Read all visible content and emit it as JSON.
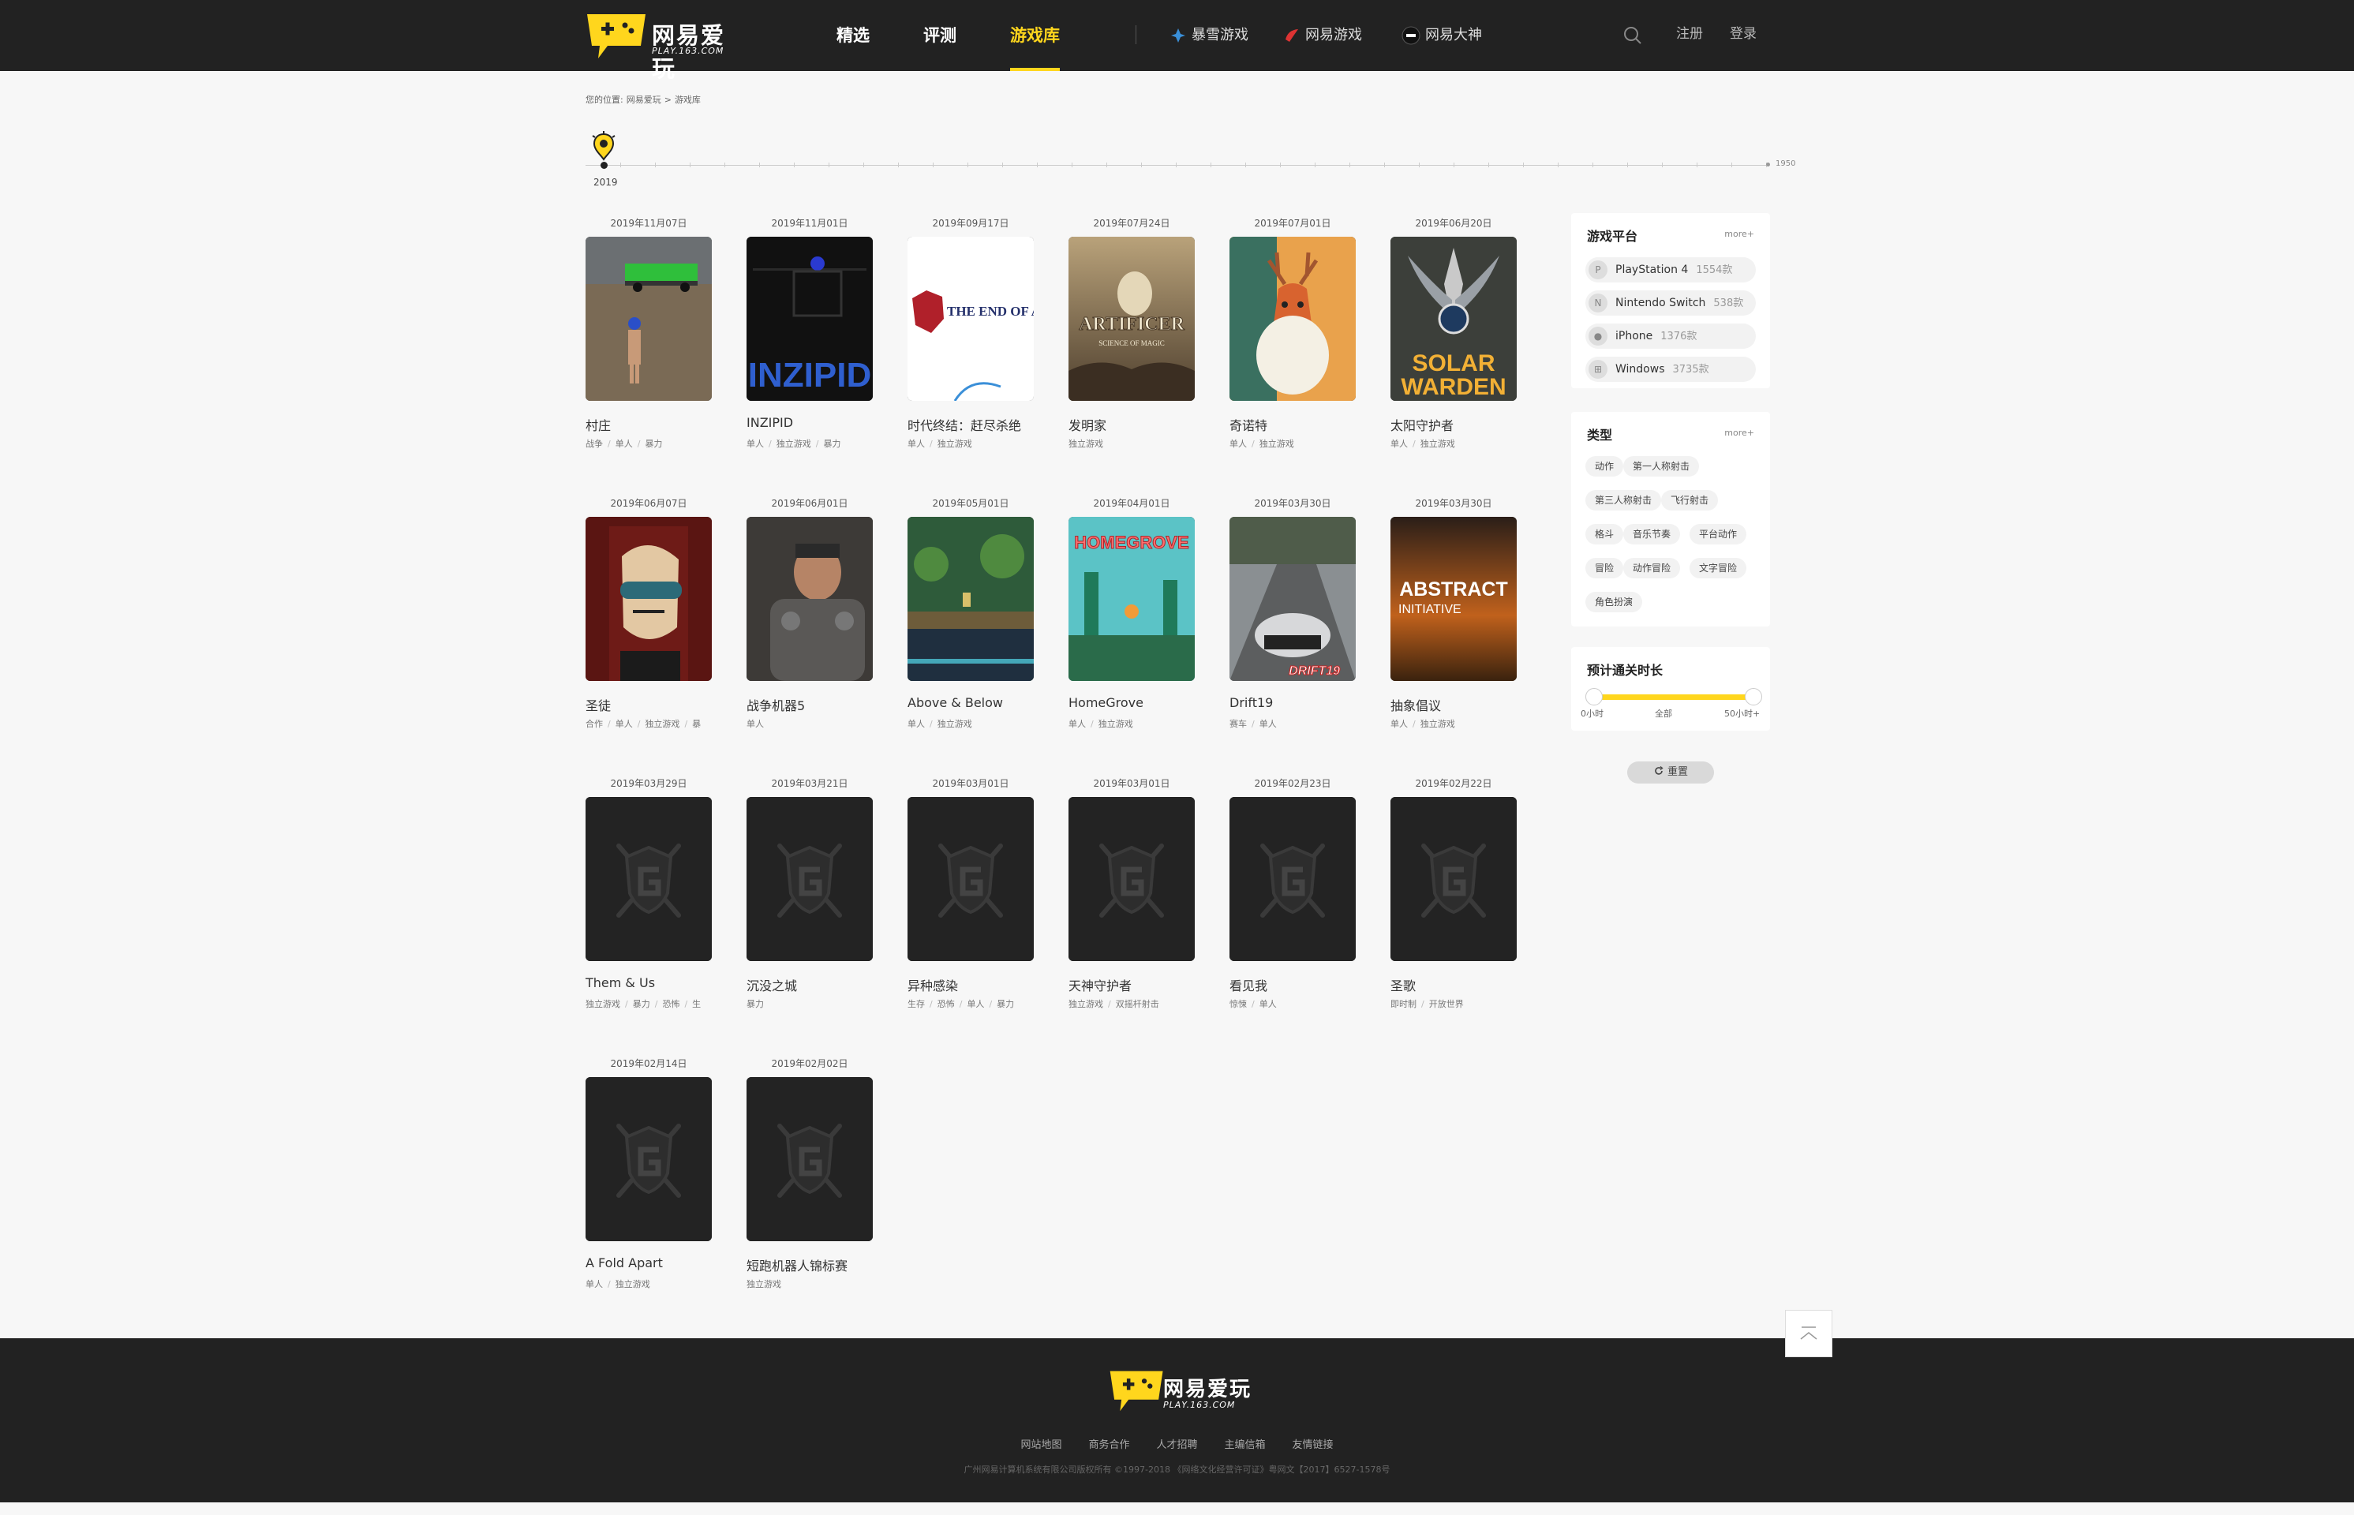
{
  "brand": {
    "name": "网易爱玩",
    "url": "PLAY.163.COM"
  },
  "nav": {
    "items": [
      {
        "label": "精选"
      },
      {
        "label": "评测"
      },
      {
        "label": "游戏库"
      }
    ],
    "partners": [
      {
        "label": "暴雪游戏"
      },
      {
        "label": "网易游戏"
      },
      {
        "label": "网易大神"
      }
    ],
    "register": "注册",
    "login": "登录"
  },
  "breadcrumb": {
    "prefix": "您的位置:",
    "home": "网易爱玩",
    "sep": ">",
    "current": "游戏库"
  },
  "timeline": {
    "start": "2019",
    "end": "1950"
  },
  "games": [
    {
      "date": "2019年11月07日",
      "title": "村庄",
      "tags": [
        "战争",
        "单人",
        "暴力"
      ]
    },
    {
      "date": "2019年11月01日",
      "title": "INZIPID",
      "tags": [
        "单人",
        "独立游戏",
        "暴力"
      ]
    },
    {
      "date": "2019年09月17日",
      "title": "时代终结：赶尽杀绝",
      "tags": [
        "单人",
        "独立游戏"
      ]
    },
    {
      "date": "2019年07月24日",
      "title": "发明家",
      "tags": [
        "独立游戏"
      ]
    },
    {
      "date": "2019年07月01日",
      "title": "奇诺特",
      "tags": [
        "单人",
        "独立游戏"
      ]
    },
    {
      "date": "2019年06月20日",
      "title": "太阳守护者",
      "tags": [
        "单人",
        "独立游戏"
      ]
    },
    {
      "date": "2019年06月07日",
      "title": "圣徒",
      "tags": [
        "合作",
        "单人",
        "独立游戏",
        "暴"
      ]
    },
    {
      "date": "2019年06月01日",
      "title": "战争机器5",
      "tags": [
        "单人"
      ]
    },
    {
      "date": "2019年05月01日",
      "title": "Above & Below",
      "tags": [
        "单人",
        "独立游戏"
      ]
    },
    {
      "date": "2019年04月01日",
      "title": "HomeGrove",
      "tags": [
        "单人",
        "独立游戏"
      ]
    },
    {
      "date": "2019年03月30日",
      "title": "Drift19",
      "tags": [
        "赛车",
        "单人"
      ]
    },
    {
      "date": "2019年03月30日",
      "title": "抽象倡议",
      "tags": [
        "单人",
        "独立游戏"
      ]
    },
    {
      "date": "2019年03月29日",
      "title": "Them & Us",
      "tags": [
        "独立游戏",
        "暴力",
        "恐怖",
        "生"
      ]
    },
    {
      "date": "2019年03月21日",
      "title": "沉没之城",
      "tags": [
        "暴力"
      ]
    },
    {
      "date": "2019年03月01日",
      "title": "异种感染",
      "tags": [
        "生存",
        "恐怖",
        "单人",
        "暴力"
      ]
    },
    {
      "date": "2019年03月01日",
      "title": "天神守护者",
      "tags": [
        "独立游戏",
        "双摇杆射击"
      ]
    },
    {
      "date": "2019年02月23日",
      "title": "看见我",
      "tags": [
        "惊悚",
        "单人"
      ]
    },
    {
      "date": "2019年02月22日",
      "title": "圣歌",
      "tags": [
        "即时制",
        "开放世界"
      ]
    },
    {
      "date": "2019年02月14日",
      "title": "A Fold Apart",
      "tags": [
        "单人",
        "独立游戏"
      ]
    },
    {
      "date": "2019年02月02日",
      "title": "短跑机器人锦标赛",
      "tags": [
        "独立游戏"
      ]
    }
  ],
  "covers": {
    "inzipid": "INZIPID",
    "end_of_age": "THE END OF AN AGE",
    "artificer": "ARTIFICER",
    "artificer_sub": "SCIENCE OF MAGIC",
    "solar1": "SOLAR",
    "solar2": "WARDEN",
    "homegrove": "HOMEGROVE",
    "drift": "DRIFT19",
    "abstract1": "ABSTRACT",
    "abstract2": "INITIATIVE"
  },
  "sidebar": {
    "platforms_title": "游戏平台",
    "more": "more+",
    "platforms": [
      {
        "name": "PlayStation 4",
        "count": "1554款"
      },
      {
        "name": "Nintendo Switch",
        "count": "538款"
      },
      {
        "name": "iPhone",
        "count": "1376款"
      },
      {
        "name": "Windows",
        "count": "3735款"
      }
    ],
    "types_title": "类型",
    "types": [
      "动作",
      "第一人称射击",
      "第三人称射击",
      "飞行射击",
      "格斗",
      "音乐节奏",
      "平台动作",
      "冒险",
      "动作冒险",
      "文字冒险",
      "角色扮演"
    ],
    "duration_title": "预计通关时长",
    "duration_min": "0小时",
    "duration_mid": "全部",
    "duration_max": "50小时+",
    "reset": "重置"
  },
  "footer": {
    "links": [
      "网站地图",
      "商务合作",
      "人才招聘",
      "主编信箱",
      "友情链接"
    ],
    "copyright": "广州网易计算机系统有限公司版权所有 ©1997-2018  《网络文化经营许可证》粤网文【2017】6527-1578号"
  },
  "colors": {
    "accent": "#ffd61d",
    "header_bg": "#222222",
    "page_bg": "#f7f7f7"
  }
}
